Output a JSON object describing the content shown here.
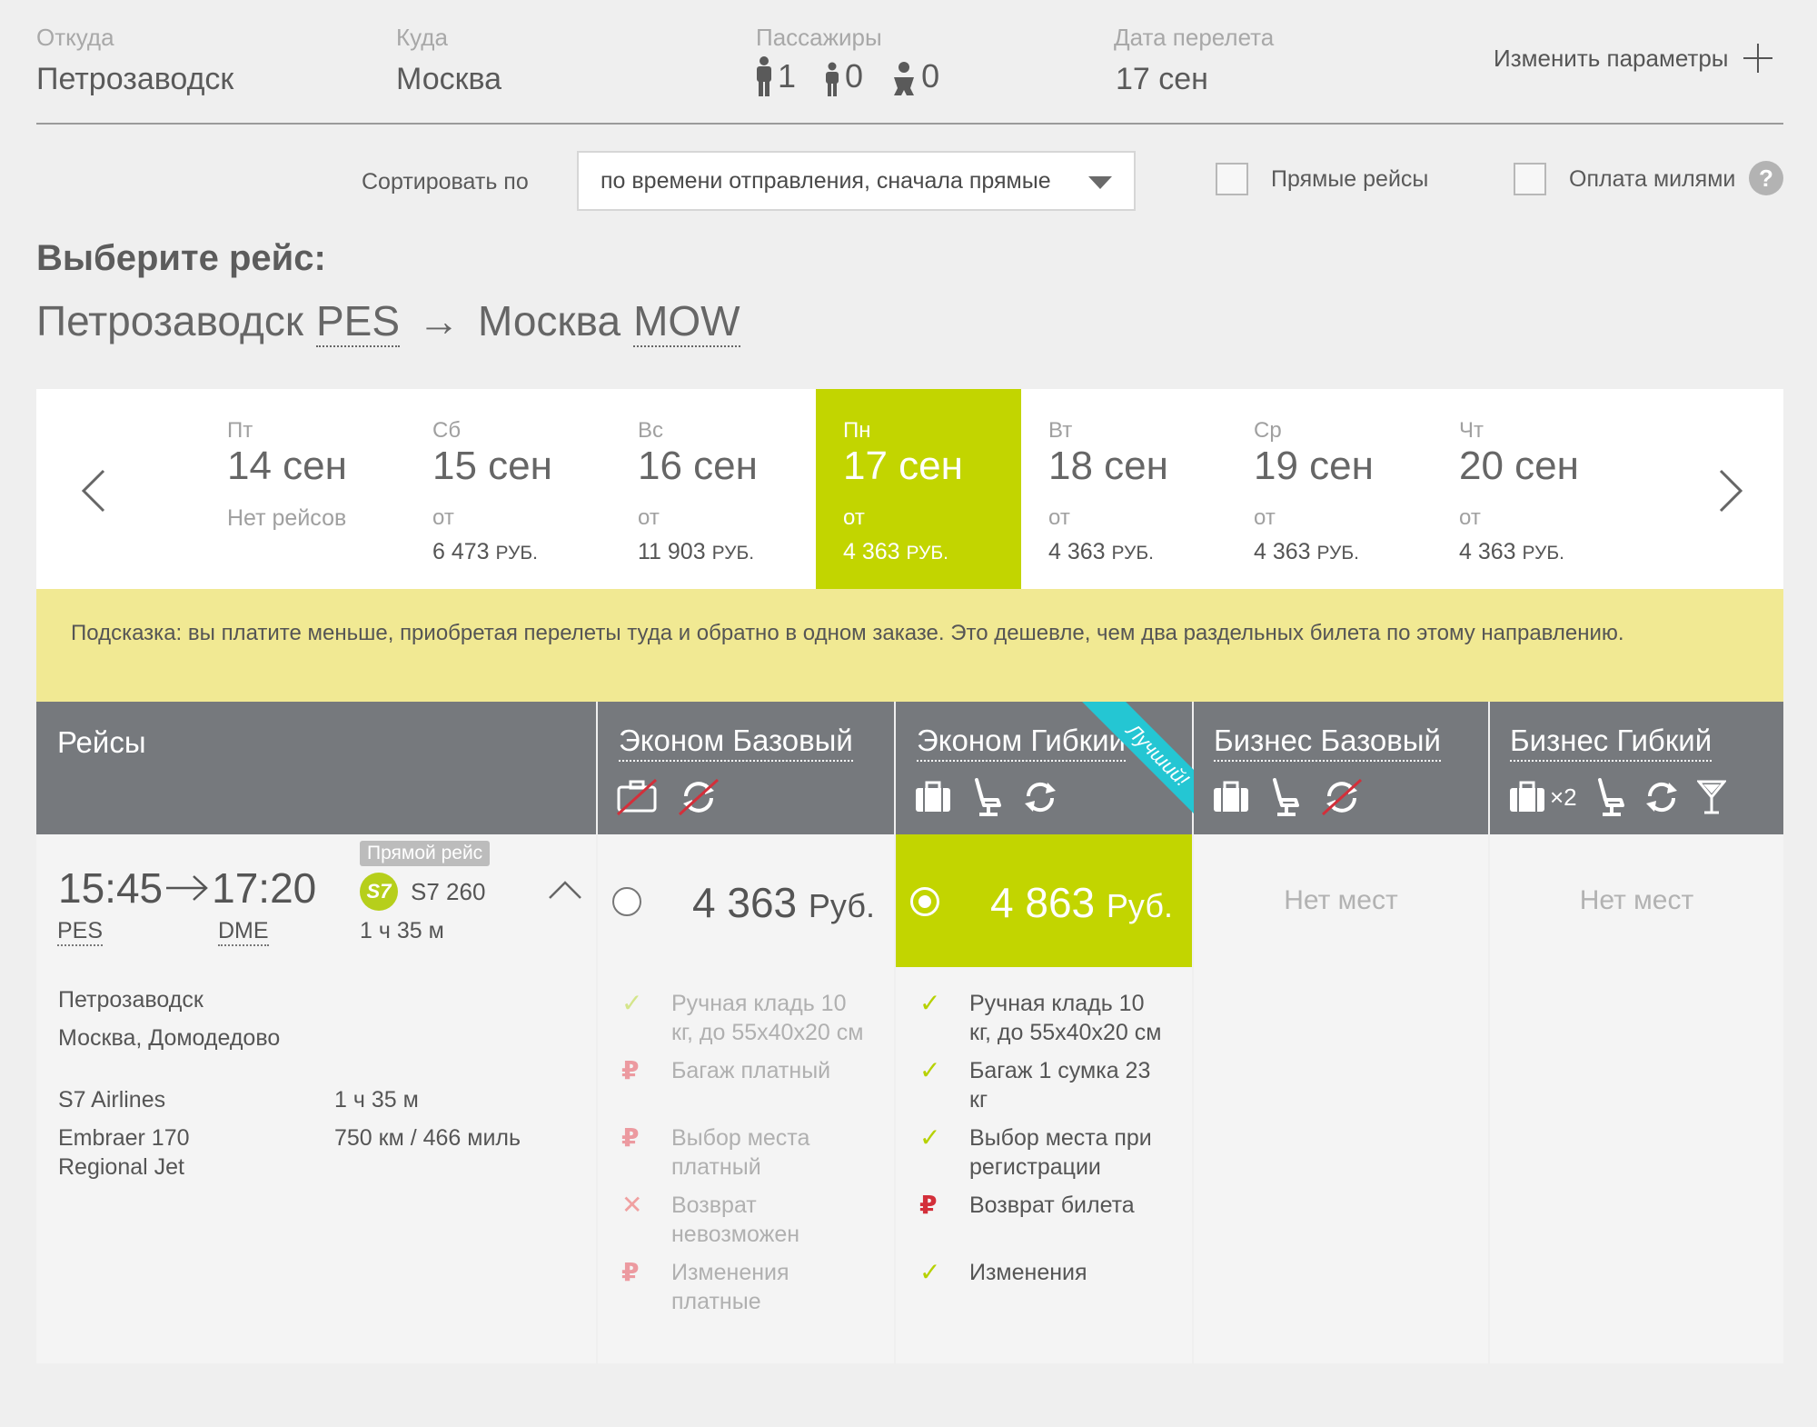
{
  "header": {
    "from_label": "Откуда",
    "from_value": "Петрозаводск",
    "to_label": "Куда",
    "to_value": "Москва",
    "pax_label": "Пассажиры",
    "pax_adults": "1",
    "pax_children": "0",
    "pax_infants": "0",
    "date_label": "Дата перелета",
    "date_value": "17 сен",
    "change_params": "Изменить параметры"
  },
  "filters": {
    "sort_label": "Сортировать по",
    "sort_value": "по времени отправления, сначала прямые",
    "direct_label": "Прямые рейсы",
    "miles_label": "Оплата милями",
    "help": "?"
  },
  "page": {
    "title": "Выберите рейс:",
    "origin_city": "Петрозаводск",
    "origin_code": "PES",
    "arrow": "→",
    "dest_city": "Москва",
    "dest_code": "MOW"
  },
  "dates": [
    {
      "dow": "Пт",
      "date": "14 сен",
      "from": "",
      "price": "",
      "currency": "",
      "note": "Нет рейсов",
      "active": false
    },
    {
      "dow": "Сб",
      "date": "15 сен",
      "from": "от",
      "price": "6 473",
      "currency": "РУБ.",
      "note": "",
      "active": false
    },
    {
      "dow": "Вс",
      "date": "16 сен",
      "from": "от",
      "price": "11 903",
      "currency": "РУБ.",
      "note": "",
      "active": false
    },
    {
      "dow": "Пн",
      "date": "17 сен",
      "from": "от",
      "price": "4 363",
      "currency": "РУБ.",
      "note": "",
      "active": true
    },
    {
      "dow": "Вт",
      "date": "18 сен",
      "from": "от",
      "price": "4 363",
      "currency": "РУБ.",
      "note": "",
      "active": false
    },
    {
      "dow": "Ср",
      "date": "19 сен",
      "from": "от",
      "price": "4 363",
      "currency": "РУБ.",
      "note": "",
      "active": false
    },
    {
      "dow": "Чт",
      "date": "20 сен",
      "from": "от",
      "price": "4 363",
      "currency": "РУБ.",
      "note": "",
      "active": false
    }
  ],
  "hint": "Подсказка: вы платите меньше, приобретая перелеты туда и обратно в одном заказе. Это дешевле, чем два раздельных билета по этому направлению.",
  "table": {
    "flights_header": "Рейсы",
    "fares": [
      {
        "name": "Эконом Базовый"
      },
      {
        "name": "Эконом Гибкий",
        "ribbon": "Лучший!"
      },
      {
        "name": "Бизнес Базовый"
      },
      {
        "name": "Бизнес Гибкий",
        "bag_mult": "×2"
      }
    ]
  },
  "flight": {
    "badge": "Прямой рейс",
    "dep_time": "15:45",
    "arr_time": "17:20",
    "dep_code": "PES",
    "arr_code": "DME",
    "airline_logo": "S7",
    "flight_no": "S7 260",
    "duration": "1 ч 35 м",
    "dep_city": "Петрозаводск",
    "arr_city": "Москва, Домодедово",
    "airline": "S7 Airlines",
    "aircraft_1": "Embraer 170",
    "aircraft_2": "Regional Jet",
    "duration2": "1 ч 35 м",
    "distance": "750 км / 466 миль"
  },
  "offers": {
    "eco_basic": {
      "price": "4 363",
      "currency": "Руб.",
      "features": [
        {
          "icon": "check-icon",
          "text": "Ручная кладь 10 кг, до 55х40х20 см"
        },
        {
          "icon": "ruble-icon",
          "text": "Багаж платный"
        },
        {
          "icon": "ruble-icon",
          "text": "Выбор места платный"
        },
        {
          "icon": "cross-icon",
          "text": "Возврат невозможен"
        },
        {
          "icon": "ruble-icon",
          "text": "Изменения платные"
        }
      ]
    },
    "eco_flex": {
      "price": "4 863",
      "currency": "Руб.",
      "features": [
        {
          "icon": "check-icon",
          "text": "Ручная кладь 10 кг, до 55х40х20 см"
        },
        {
          "icon": "check-icon",
          "text": "Багаж 1 сумка 23 кг"
        },
        {
          "icon": "check-icon",
          "text": "Выбор места при регистрации"
        },
        {
          "icon": "ruble-icon",
          "text": "Возврат билета"
        },
        {
          "icon": "check-icon",
          "text": "Изменения"
        }
      ]
    },
    "biz_basic": {
      "no_seats": "Нет мест"
    },
    "biz_flex": {
      "no_seats": "Нет мест"
    }
  },
  "colors": {
    "accent_green": "#c2d500",
    "hint_yellow": "#f1e993",
    "header_gray": "#76797d",
    "ribbon_cyan": "#24c6d3"
  }
}
